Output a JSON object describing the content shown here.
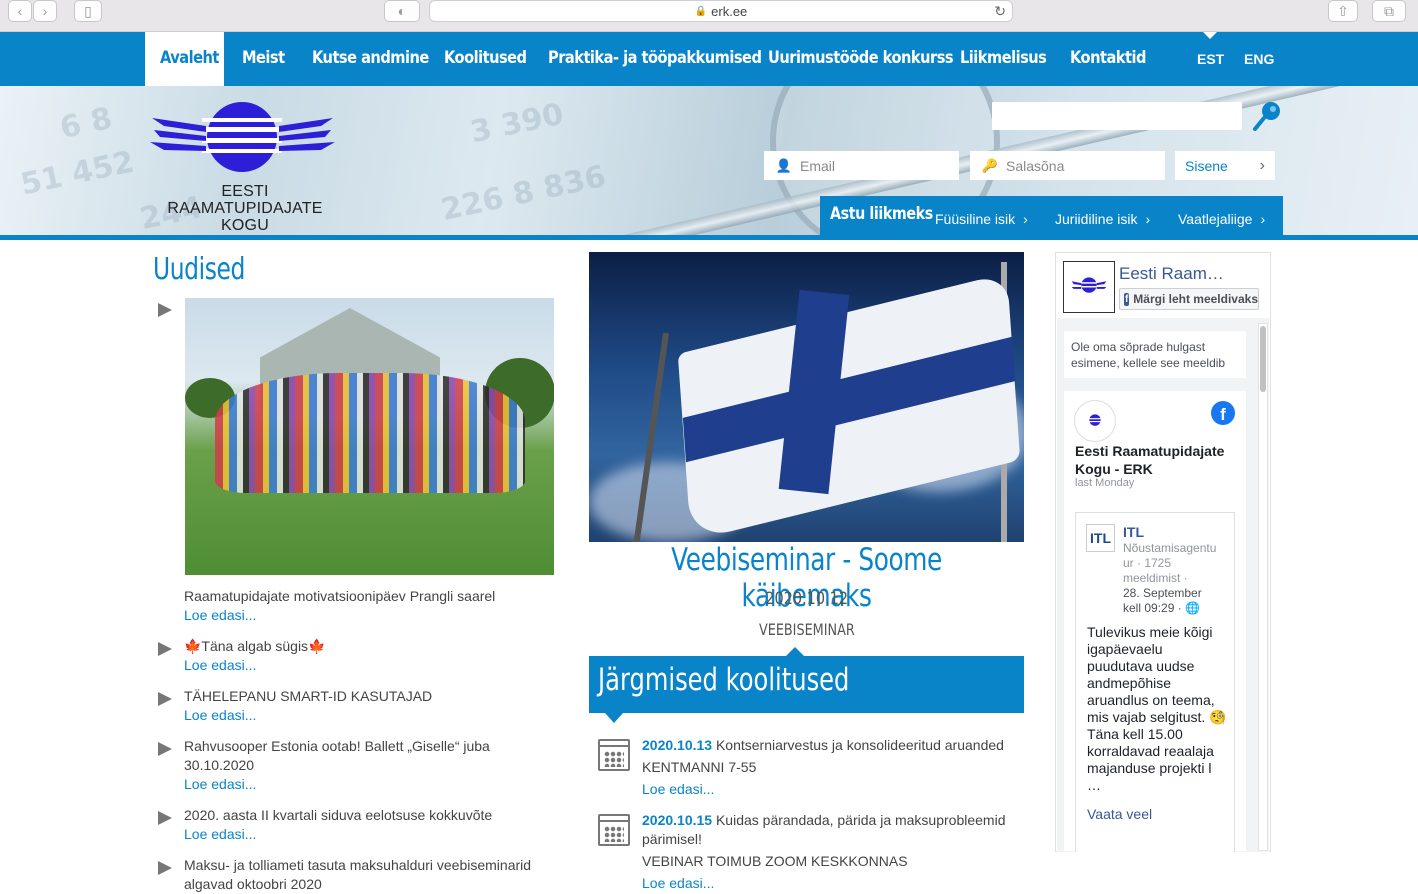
{
  "browser": {
    "url": "erk.ee"
  },
  "nav": {
    "items": [
      "Avaleht",
      "Meist",
      "Kutse andmine",
      "Koolitused",
      "Praktika- ja tööpakkumised",
      "Uurimustööde konkurss",
      "Liikmelisus",
      "Kontaktid"
    ],
    "active": "Avaleht",
    "langs": [
      "EST",
      "ENG"
    ],
    "active_lang": "EST"
  },
  "logo": {
    "line1": "EESTI",
    "line2": "RAAMATUPIDAJATE",
    "line3": "KOGU"
  },
  "login": {
    "email_placeholder": "Email",
    "password_placeholder": "Salasõna",
    "submit": "Sisene"
  },
  "join": {
    "title": "Astu liikmeks",
    "links": [
      "Füüsiline isik",
      "Juriidiline isik",
      "Vaatlejaliige"
    ]
  },
  "news": {
    "title": "Uudised",
    "read_more": "Loe edasi...",
    "items": [
      "Raamatupidajate motivatsioonipäev Prangli saarel",
      "🍁Täna algab sügis🍁",
      "TÄHELEPANU SMART-ID KASUTAJAD",
      "Rahvusooper Estonia ootab! Ballett „Giselle“ juba 30.10.2020",
      "2020. aasta II kvartali siduva eelotsuse kokkuvõte",
      "Maksu- ja tolliameti tasuta maksuhalduri veebiseminarid algavad oktoobri 2020"
    ]
  },
  "featured": {
    "title": "Veebiseminar - Soome käibemaks",
    "date": "2020.10.12",
    "category": "VEEBISEMINAR"
  },
  "upcoming": {
    "title": "Järgmised koolitused",
    "read_more": "Loe edasi...",
    "events": [
      {
        "date": "2020.10.13",
        "title": "Kontserniarvestus ja konsolideeritud aruanded",
        "extra": "KENTMANNI 7-55"
      },
      {
        "date": "2020.10.15",
        "title": "Kuidas pärandada, pärida ja maksuprobleemid",
        "title2": "pärimisel!",
        "extra": "VEBINAR TOIMUB ZOOM KESKKONNAS"
      }
    ]
  },
  "facebook": {
    "page_name": "Eesti Raam…",
    "like_button": "Märgi leht meeldivaks",
    "friends_text": "Ole oma sõprade hulgast esimene, kellele see meeldib",
    "post_author": "Eesti Raamatupidajate Kogu - ERK",
    "post_time": "last Monday",
    "shared_name": "ITL",
    "shared_meta_1": "Nõustamisagentu",
    "shared_meta_2": "ur · 1725",
    "shared_meta_3": "meeldimist ·",
    "shared_meta_date": "28. September kell 09:29 · 🌐",
    "shared_text": "Tulevikus meie kõigi igapäevaelu puudutava uudse andmepõhise aruandlus on teema, mis vajab selgitust. 🧐Täna kell 15.00 korraldavad reaalaja majanduse projekti l …",
    "see_more": "Vaata veel"
  },
  "colors": {
    "brand_blue": "#0a84c9",
    "fb_blue": "#385898"
  }
}
